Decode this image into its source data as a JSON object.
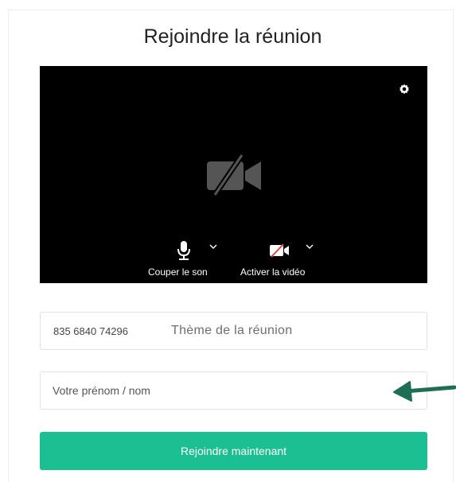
{
  "dialog": {
    "title": "Rejoindre la réunion"
  },
  "preview": {
    "settings_icon": "gear-icon",
    "camera_off_icon": "video-off-icon",
    "audio_control": {
      "icon": "microphone-icon",
      "label": "Couper le son"
    },
    "video_control": {
      "icon": "video-off-icon",
      "label": "Activer la vidéo"
    }
  },
  "meeting": {
    "id": "835 6840 74296",
    "topic": "Thème de la réunion"
  },
  "name_field": {
    "value": "",
    "placeholder": "Votre prénom / nom"
  },
  "join_button": {
    "label": "Rejoindre maintenant"
  },
  "colors": {
    "accent": "#1cbf92",
    "arrow": "#1e6e55",
    "preview_bg": "#000000",
    "video_off_slash": "#e0443e"
  }
}
